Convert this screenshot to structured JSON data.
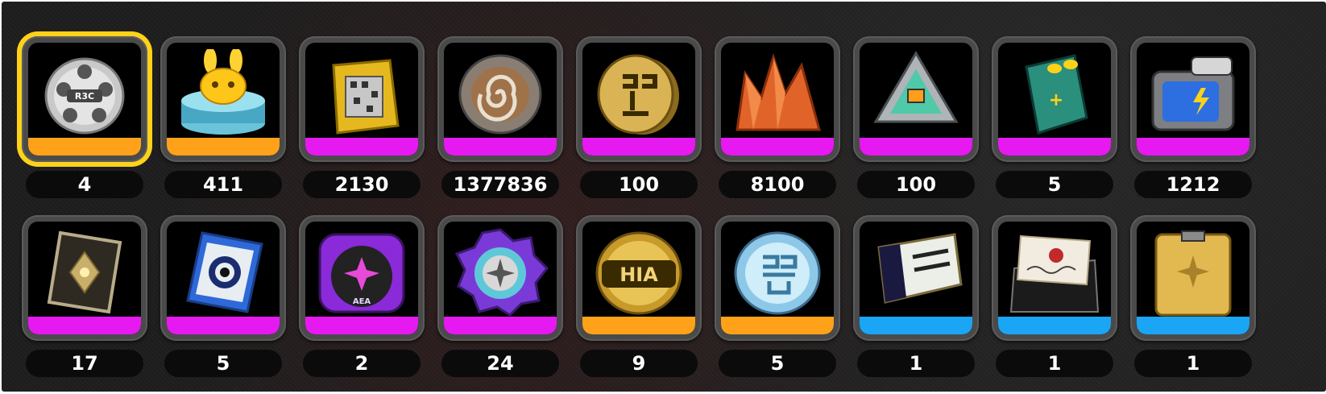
{
  "items": [
    {
      "icon": "film-reel-icon",
      "rarity": "orange",
      "count": "4",
      "selected": true
    },
    {
      "icon": "golden-bunny-statue-icon",
      "rarity": "orange",
      "count": "411"
    },
    {
      "icon": "gold-data-cube-icon",
      "rarity": "magenta",
      "count": "2130"
    },
    {
      "icon": "spiral-coin-icon",
      "rarity": "magenta",
      "count": "1377836"
    },
    {
      "icon": "gold-glyph-coin-icon",
      "rarity": "magenta",
      "count": "100"
    },
    {
      "icon": "origami-crystal-icon",
      "rarity": "magenta",
      "count": "8100"
    },
    {
      "icon": "circuit-chip-icon",
      "rarity": "magenta",
      "count": "100"
    },
    {
      "icon": "battery-icon",
      "rarity": "magenta",
      "count": "5"
    },
    {
      "icon": "power-cell-icon",
      "rarity": "magenta",
      "count": "1212"
    },
    {
      "icon": "ornate-card-icon",
      "rarity": "magenta",
      "count": "17"
    },
    {
      "icon": "blue-eye-card-icon",
      "rarity": "magenta",
      "count": "5"
    },
    {
      "icon": "purple-badge-icon",
      "rarity": "magenta",
      "count": "2"
    },
    {
      "icon": "star-gear-badge-icon",
      "rarity": "magenta",
      "count": "24"
    },
    {
      "icon": "hia-gold-coin-icon",
      "rarity": "orange",
      "count": "9"
    },
    {
      "icon": "silver-glyph-coin-icon",
      "rarity": "orange",
      "count": "5"
    },
    {
      "icon": "ticket-icon",
      "rarity": "blue",
      "count": "1"
    },
    {
      "icon": "sealed-letter-icon",
      "rarity": "blue",
      "count": "1"
    },
    {
      "icon": "gold-crate-icon",
      "rarity": "blue",
      "count": "1"
    }
  ],
  "colors": {
    "orange": "#ffa21a",
    "magenta": "#e619f0",
    "blue": "#1aa6f5",
    "selected": "#ffd21a"
  },
  "icon_text": {
    "film_reel": "R3C",
    "coin": "HIA",
    "badge": "AEA"
  }
}
